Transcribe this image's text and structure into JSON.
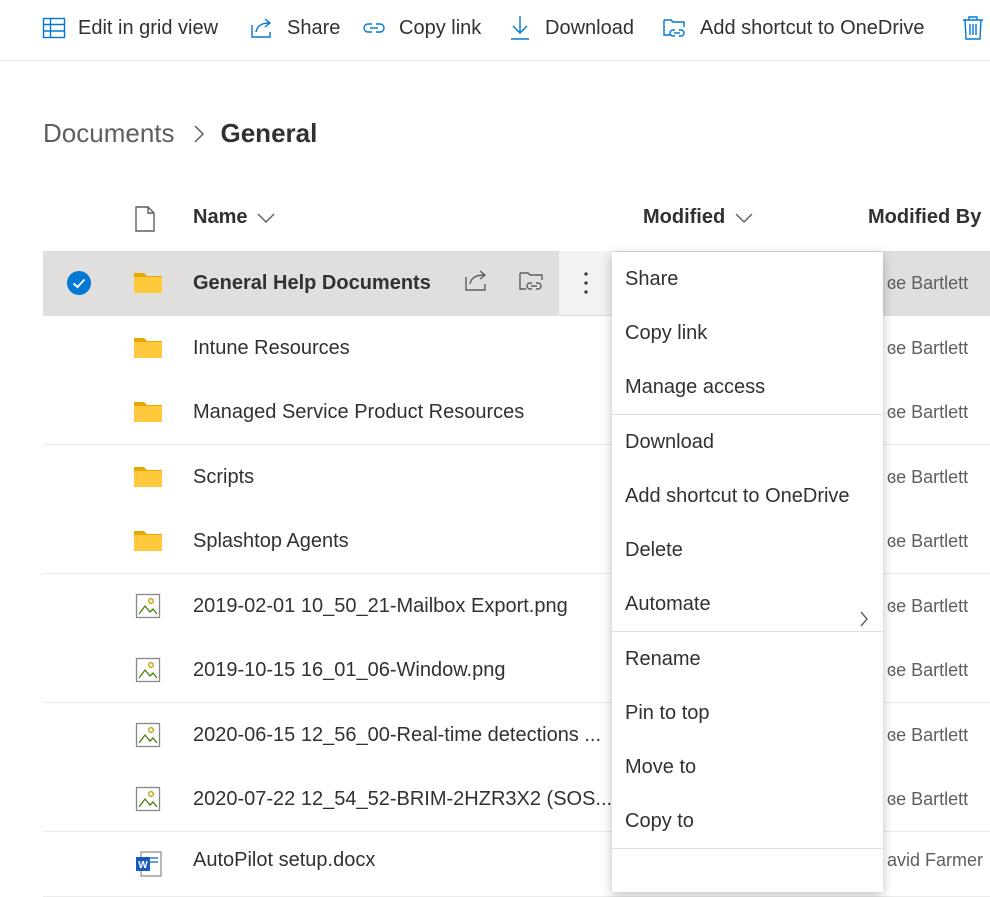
{
  "toolbar": {
    "grid_view": "Edit in grid view",
    "share": "Share",
    "copy_link": "Copy link",
    "download": "Download",
    "add_shortcut": "Add shortcut to OneDrive",
    "delete_icon": "trash-icon"
  },
  "breadcrumb": {
    "root": "Documents",
    "current": "General"
  },
  "columns": {
    "name": "Name",
    "modified": "Modified",
    "modified_by": "Modified By"
  },
  "rows": [
    {
      "name": "General Help Documents",
      "type": "folder",
      "modified_by": "ɞe Bartlett",
      "selected": true
    },
    {
      "name": "Intune Resources",
      "type": "folder",
      "modified_by": "ɞe Bartlett"
    },
    {
      "name": "Managed Service Product Resources",
      "type": "folder",
      "modified_by": "ɞe Bartlett"
    },
    {
      "name": "Scripts",
      "type": "folder",
      "modified_by": "ɞe Bartlett"
    },
    {
      "name": "Splashtop Agents",
      "type": "folder",
      "modified_by": "ɞe Bartlett"
    },
    {
      "name": "2019-02-01 10_50_21-Mailbox Export.png",
      "type": "image",
      "modified_by": "ɞe Bartlett"
    },
    {
      "name": "2019-10-15 16_01_06-Window.png",
      "type": "image",
      "modified_by": "ɞe Bartlett"
    },
    {
      "name": "2020-06-15 12_56_00-Real-time detections ...",
      "type": "image",
      "modified_by": "ɞe Bartlett"
    },
    {
      "name": "2020-07-22 12_54_52-BRIM-2HZR3X2 (SOS...",
      "type": "image",
      "modified_by": "ɞe Bartlett"
    },
    {
      "name": "AutoPilot setup.docx",
      "type": "word",
      "modified_by": "avid Farmer"
    }
  ],
  "context_menu": {
    "share": "Share",
    "copy_link": "Copy link",
    "manage_access": "Manage access",
    "download": "Download",
    "add_shortcut": "Add shortcut to OneDrive",
    "delete": "Delete",
    "automate": "Automate",
    "rename": "Rename",
    "pin_to_top": "Pin to top",
    "move_to": "Move to",
    "copy_to": "Copy to"
  },
  "colors": {
    "accent": "#0078d4",
    "folder": "#ffb900",
    "selected_row": "#e1dfdd"
  }
}
